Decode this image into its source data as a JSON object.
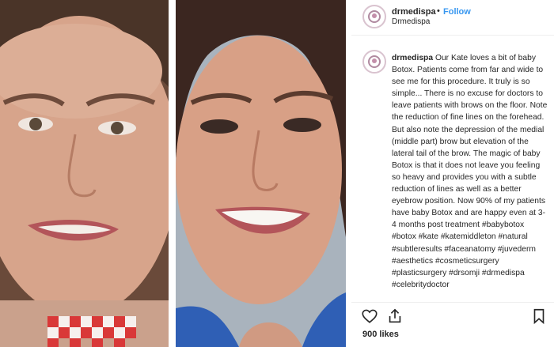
{
  "header": {
    "username": "drmedispa",
    "separator": "•",
    "follow_label": "Follow",
    "subtitle": "Drmedispa"
  },
  "caption": {
    "username": "drmedispa",
    "text": " Our Kate loves a bit of baby Botox. Patients come from far and wide to see me for this procedure. It truly is so simple... There is no excuse for doctors to leave patients with brows on the floor. Note the reduction of fine lines on the forehead. But also note the depression of the medial (middle part) brow but elevation of the lateral tail of the brow. The magic of baby Botox is that it does not leave you feeling so heavy and provides you with a subtle reduction of lines as well as a better eyebrow position. Now 90% of my patients have baby Botox and are happy even at 3-4 months post treatment #babybotox #botox #kate #katemiddleton #natural #subtleresults #faceanatomy #juvederm #aesthetics #cosmeticsurgery #plasticsurgery #drsomji #drmedispa #celebritydoctor"
  },
  "likes": "900 likes",
  "icons": {
    "more": "more-options-icon",
    "like": "heart-icon",
    "share": "share-icon",
    "save": "bookmark-icon"
  },
  "colors": {
    "link": "#3897f0",
    "text": "#262626",
    "avatar_ring": "#b08aa0"
  }
}
